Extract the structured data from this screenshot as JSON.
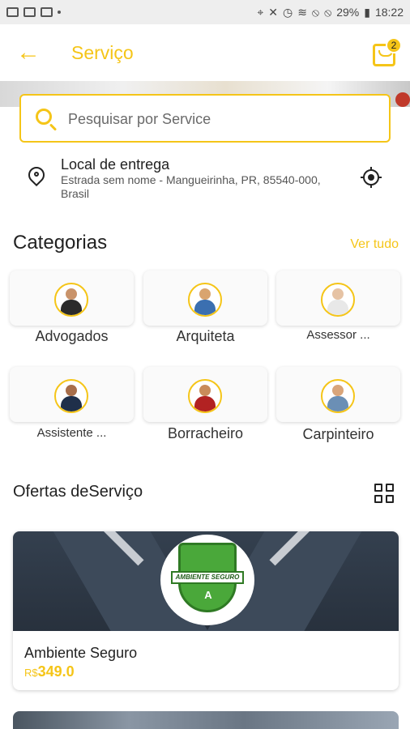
{
  "status_bar": {
    "battery": "29%",
    "time": "18:22"
  },
  "header": {
    "title": "Serviço",
    "cart_count": "2"
  },
  "search": {
    "placeholder": "Pesquisar por Service"
  },
  "delivery": {
    "title": "Local de entrega",
    "address": "Estrada sem nome - Mangueirinha, PR, 85540-000, Brasil"
  },
  "categories": {
    "title": "Categorias",
    "see_all": "Ver tudo",
    "items": [
      {
        "label": "Advogados"
      },
      {
        "label": "Arquiteta"
      },
      {
        "label": "Assessor ..."
      },
      {
        "label": "Assistente ..."
      },
      {
        "label": "Borracheiro"
      },
      {
        "label": "Carpinteiro"
      }
    ]
  },
  "offers": {
    "title": "Ofertas deServiço",
    "items": [
      {
        "name": "Ambiente Seguro",
        "currency": "R$",
        "price": "349.0",
        "logo_text": "AMBIENTE SEGURO",
        "logo_letter": "A"
      }
    ]
  },
  "colors": {
    "accent": "#f5c518"
  }
}
